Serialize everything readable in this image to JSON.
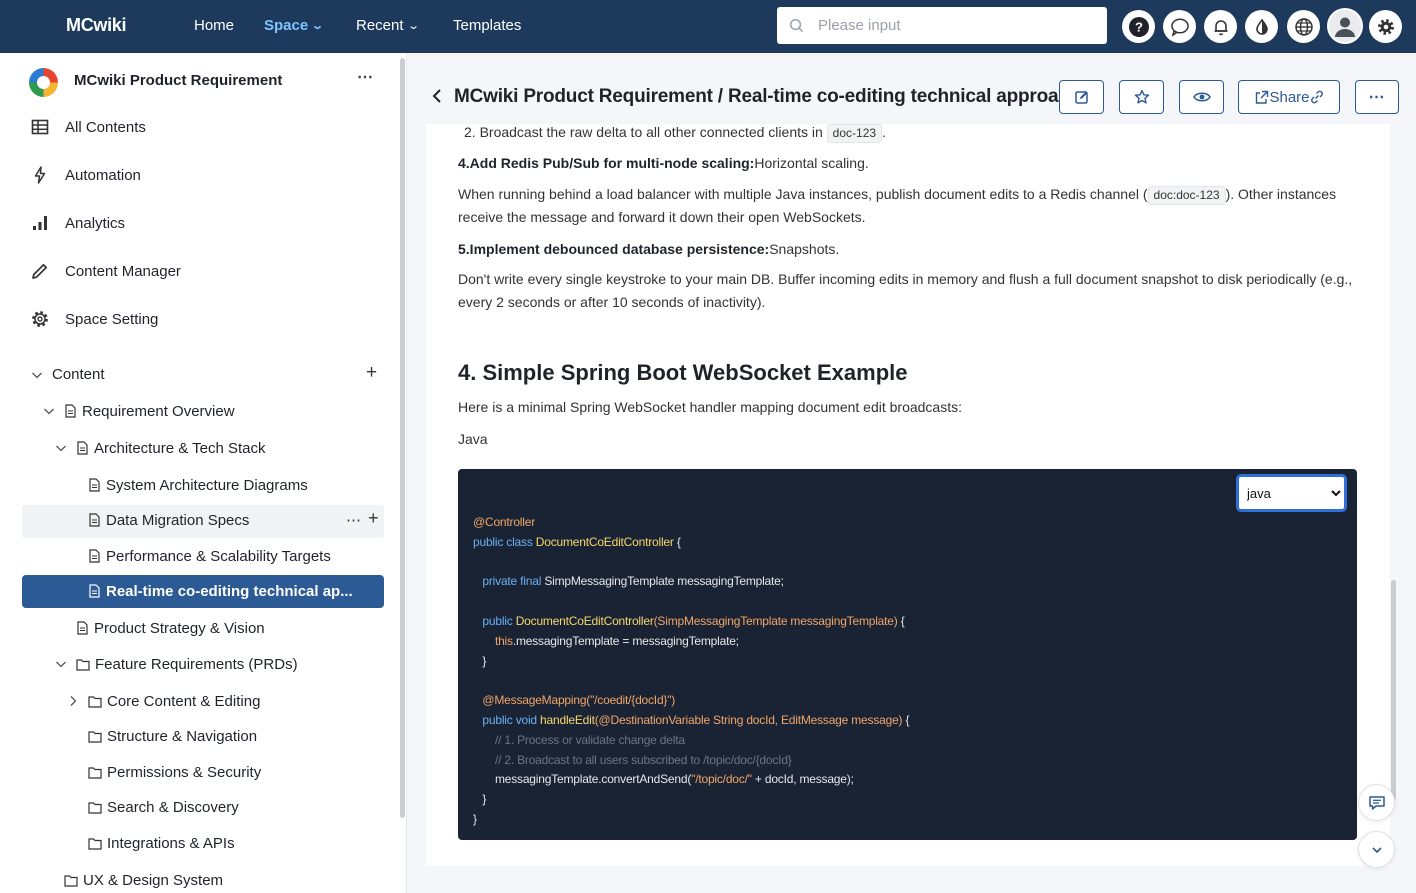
{
  "app": {
    "name": "MCwiki"
  },
  "nav": {
    "home": "Home",
    "space": "Space",
    "recent": "Recent",
    "templates": "Templates"
  },
  "search": {
    "placeholder": "Please input"
  },
  "sidebar": {
    "space_title": "MCwiki Product Requirement",
    "menu": [
      {
        "label": "All Contents",
        "icon": "table-icon"
      },
      {
        "label": "Automation",
        "icon": "lightning-icon"
      },
      {
        "label": "Analytics",
        "icon": "bar-chart-icon"
      },
      {
        "label": "Content Manager",
        "icon": "pencil-icon"
      },
      {
        "label": "Space Setting",
        "icon": "gear-icon"
      }
    ],
    "content_label": "Content",
    "tree": [
      {
        "label": "Requirement Overview"
      },
      {
        "label": "Architecture & Tech Stack"
      },
      {
        "label": "System Architecture Diagrams"
      },
      {
        "label": "Data Migration Specs"
      },
      {
        "label": "Performance & Scalability Targets"
      },
      {
        "label": "Real-time co-editing technical ap..."
      },
      {
        "label": "Product Strategy & Vision"
      },
      {
        "label": "Feature Requirements (PRDs)"
      },
      {
        "label": "Core Content & Editing"
      },
      {
        "label": "Structure & Navigation"
      },
      {
        "label": "Permissions & Security"
      },
      {
        "label": "Search & Discovery"
      },
      {
        "label": "Integrations & APIs"
      },
      {
        "label": "UX & Design System"
      }
    ]
  },
  "page": {
    "breadcrumb_title": "MCwiki Product Requirement / Real-time co-editing technical approach",
    "share_label": "Share",
    "list_item_2_num": "2.",
    "list_item_2_text": "Broadcast the raw delta to all other connected clients in",
    "list_item_2_code": "doc-123",
    "step4_title": "4.Add Redis Pub/Sub for multi-node scaling:",
    "step4_tail": "Horizontal scaling.",
    "step4_body_a": "When running behind a load balancer with multiple Java instances, publish document edits to a Redis channel (",
    "step4_body_code": "doc:doc-123",
    "step4_body_b": "). Other instances receive the message and forward it down their open WebSockets.",
    "step5_title": "5.Implement debounced database persistence:",
    "step5_tail": "Snapshots.",
    "step5_body": "Don't write every single keystroke to your main DB. Buffer incoming edits in memory and flush a full document snapshot to disk periodically (e.g., every 2 seconds or after 10 seconds of inactivity).",
    "section4_heading": "4. Simple Spring Boot WebSocket Example",
    "section4_intro": "Here is a minimal Spring WebSocket handler mapping document edit broadcasts:",
    "lang_label": "Java",
    "code_lang_selected": "java",
    "code": {
      "l1": "@Controller",
      "l2_kw": "public class ",
      "l2_cls": "DocumentCoEditController",
      "l2_end": " {",
      "l3_kw": "private final ",
      "l3_rest": "SimpMessagingTemplate messagingTemplate;",
      "l4_kw": "public ",
      "l4_fn": "DocumentCoEditController",
      "l4_args": "(SimpMessagingTemplate messagingTemplate)",
      "l4_end": " {",
      "l5_kw": "this",
      "l5_rest": ".messagingTemplate = messagingTemplate;",
      "l6": "}",
      "l7": "@MessageMapping(\"/coedit/{docId}\")",
      "l8_kw": "public void ",
      "l8_fn": "handleEdit",
      "l8_args": "(@DestinationVariable String docId, EditMessage message)",
      "l8_end": " {",
      "l9": "// 1. Process or validate change delta",
      "l10": "// 2. Broadcast to all users subscribed to /topic/doc/{docId}",
      "l11_a": "messagingTemplate.convertAndSend(",
      "l11_str": "\"/topic/doc/\"",
      "l11_b": " + docId, message);",
      "l12": "}",
      "l13": "}"
    }
  },
  "colors": {
    "topbar": "#1d3a5c",
    "accent": "#2c5a94",
    "code_bg": "#1a2333"
  }
}
